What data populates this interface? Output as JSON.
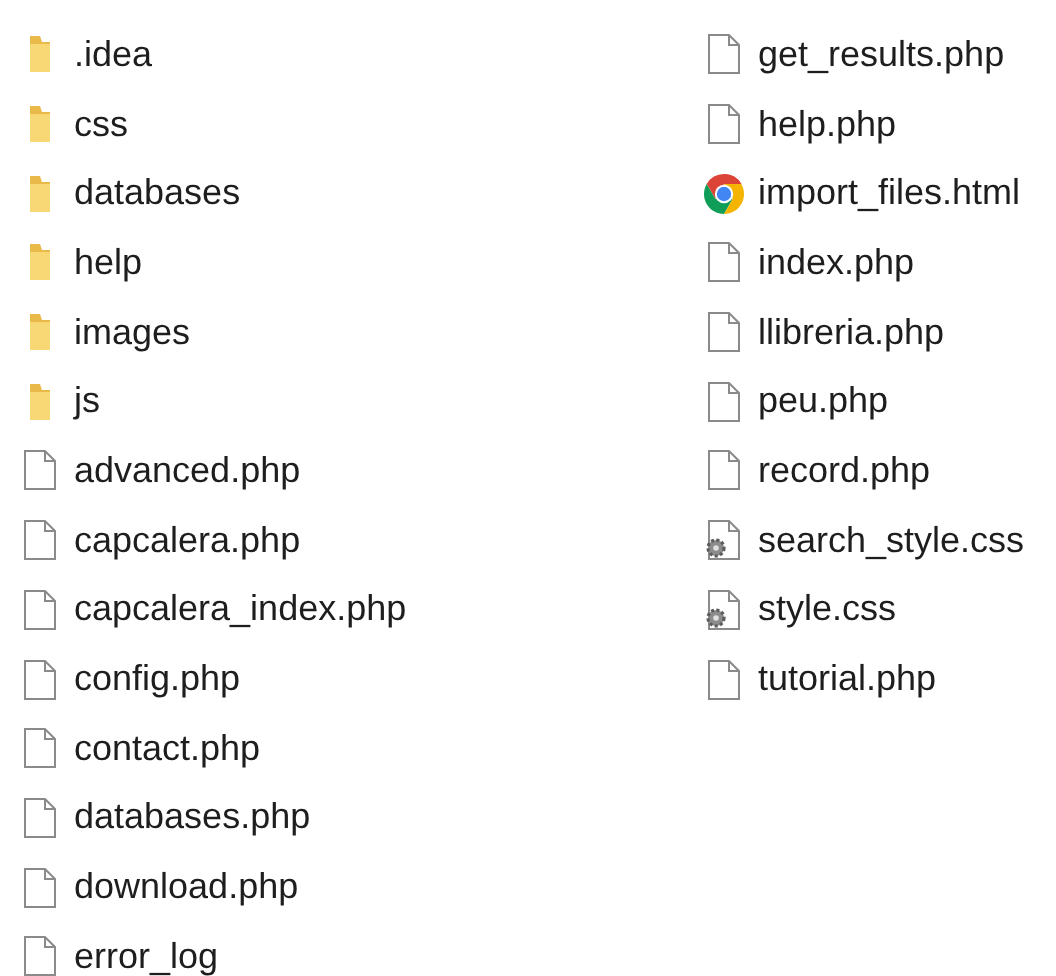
{
  "items": [
    {
      "name": ".idea",
      "kind": "folder"
    },
    {
      "name": "css",
      "kind": "folder"
    },
    {
      "name": "databases",
      "kind": "folder"
    },
    {
      "name": "help",
      "kind": "folder"
    },
    {
      "name": "images",
      "kind": "folder"
    },
    {
      "name": "js",
      "kind": "folder"
    },
    {
      "name": "advanced.php",
      "kind": "file"
    },
    {
      "name": "capcalera.php",
      "kind": "file"
    },
    {
      "name": "capcalera_index.php",
      "kind": "file"
    },
    {
      "name": "config.php",
      "kind": "file"
    },
    {
      "name": "contact.php",
      "kind": "file"
    },
    {
      "name": "databases.php",
      "kind": "file"
    },
    {
      "name": "download.php",
      "kind": "file"
    },
    {
      "name": "error_log",
      "kind": "file"
    },
    {
      "name": "get_results.php",
      "kind": "file"
    },
    {
      "name": "help.php",
      "kind": "file"
    },
    {
      "name": "import_files.html",
      "kind": "browser"
    },
    {
      "name": "index.php",
      "kind": "file"
    },
    {
      "name": "llibreria.php",
      "kind": "file"
    },
    {
      "name": "peu.php",
      "kind": "file"
    },
    {
      "name": "record.php",
      "kind": "file"
    },
    {
      "name": "search_style.css",
      "kind": "stylesheet"
    },
    {
      "name": "style.css",
      "kind": "stylesheet"
    },
    {
      "name": "tutorial.php",
      "kind": "file"
    }
  ]
}
